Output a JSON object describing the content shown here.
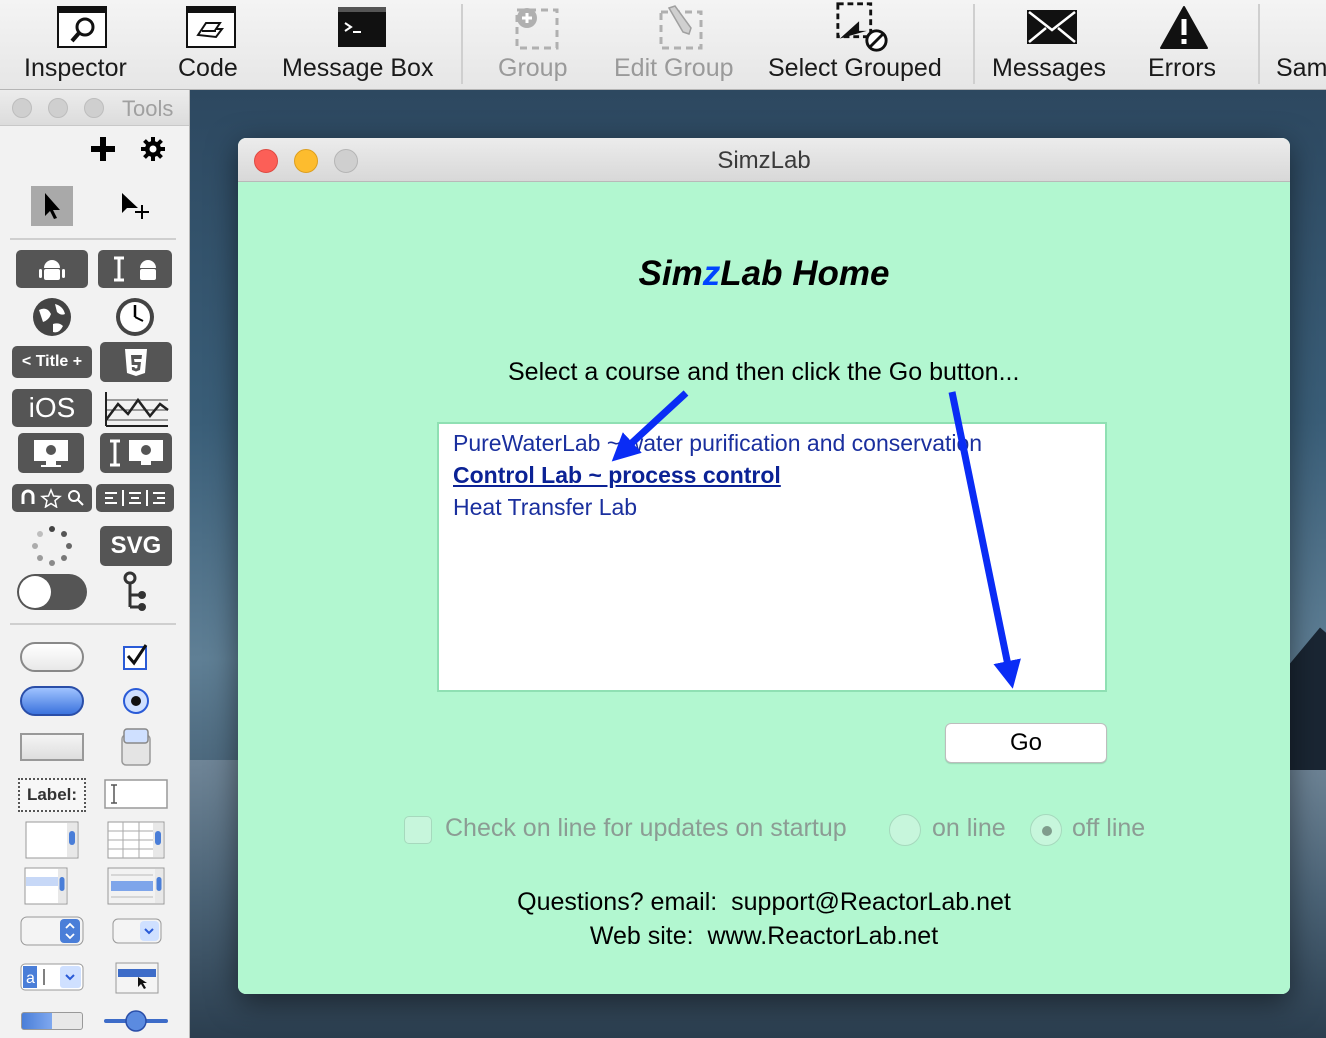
{
  "toolbar": {
    "inspector": "Inspector",
    "code": "Code",
    "message_box": "Message Box",
    "group": "Group",
    "edit_group": "Edit Group",
    "select_grouped": "Select Grouped",
    "messages": "Messages",
    "errors": "Errors",
    "sam": "Sam"
  },
  "tools_palette": {
    "title": "Tools",
    "title_tool": "< Title +",
    "ios": "iOS",
    "svg": "SVG",
    "label_tool": "Label:"
  },
  "window": {
    "title": "SimzLab",
    "heading_pre": "Sim",
    "heading_z": "z",
    "heading_post": "Lab Home",
    "instructions": "Select a course and then click the Go button...",
    "courses": [
      "PureWaterLab ~ water purification and conservation",
      "Control Lab ~ process control",
      "Heat Transfer Lab"
    ],
    "selected_course": "Control Lab ~ process control",
    "go_label": "Go",
    "check_updates_label": "Check on line for updates on startup",
    "online_label": "on line",
    "offline_label": "off line",
    "update_mode": "off line",
    "questions": "Questions? email:  support@ReactorLab.net",
    "website": "Web site:  www.ReactorLab.net"
  },
  "colors": {
    "window_bg": "#b2f7d0",
    "annotation_arrow": "#0a2cf5",
    "link_text": "#1a2f9e"
  }
}
